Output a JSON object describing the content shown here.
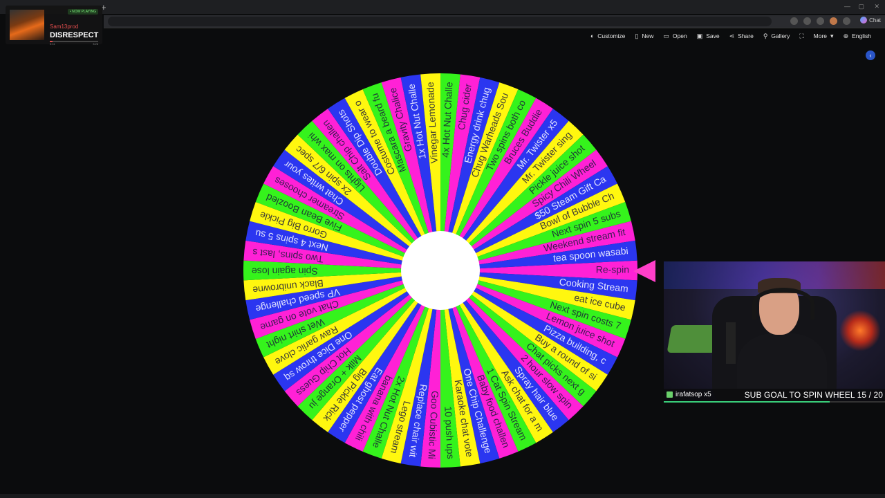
{
  "now_playing": {
    "badge": "• NOW PLAYING",
    "artist": "Sam13prod",
    "title": "DISRESPECT",
    "elapsed": "0:11",
    "duration": "3:26",
    "progress_fraction": 0.05
  },
  "toolbar": {
    "items": [
      {
        "label": "Customize",
        "icon": "palette-icon"
      },
      {
        "label": "New",
        "icon": "file-icon"
      },
      {
        "label": "Open",
        "icon": "folder-icon"
      },
      {
        "label": "Save",
        "icon": "save-icon"
      },
      {
        "label": "Share",
        "icon": "share-icon"
      },
      {
        "label": "Gallery",
        "icon": "search-icon"
      },
      {
        "label": "",
        "icon": "fullscreen-icon"
      },
      {
        "label": "More",
        "icon": "chevron-down-icon"
      },
      {
        "label": "English",
        "icon": "globe-icon"
      }
    ]
  },
  "browser": {
    "chat_label": "Chat"
  },
  "wheel": {
    "segment_colors": [
      "#ff21d6",
      "#2b36f0",
      "#fff70f",
      "#35f31c"
    ],
    "pointer_color": "#ff3fc9",
    "segments": [
      "Re-spin",
      "Cooking Stream",
      "eat ice cube",
      "Next spin costs 7",
      "Lemon juice shot",
      "Pizza building, c",
      "Buy a round of si",
      "Chat picks next g",
      "2 hour slow spin",
      "Spray hair blue",
      "Ask chat for a m",
      "1 Cat Spin Stream",
      "Baby food challen",
      "One Chip Challenge",
      "Karaoke chat vote",
      "10 push ups",
      "Goo Cubistic Mi",
      "Replace chair wit",
      "Lego stream",
      "2x Hot Nut Challe",
      "banana with chili",
      "Eat ghost pepper",
      "Big Pickle Rick",
      "Milk + Orange ju",
      "Hot Chip Guess",
      "One Dice throw sq",
      "Raw garlic clove",
      "Wet shirt night",
      "Chat vote on game",
      "VP speed challenge",
      "Black unibrowne",
      "Spin again lose",
      "Two spins, last s",
      "Next 4 spins 5 su",
      "Gorro Big Pickle",
      "Five Bean Boozled",
      "Streamer chooses",
      "Chat writes your",
      "2x spin 6/7 spec",
      "Lights on max whi",
      "Salt Chip challen",
      "Double Dip Shots",
      "Costume to wear o",
      "Mascara a beard fu",
      "Gravity Chalice",
      "1x Hot Nut Challe",
      "Vinegar Lemonade",
      "4x Hot Nut Challe",
      "Chug cider",
      "Energy drink chug",
      "Chug Warheads Sou",
      "Two spins both co",
      "Bruces Buddie",
      "Mr. Twister x5",
      "Mr. Twister sing",
      "Pickle juice shot",
      "Spicy Chili Wheel",
      "$50 Steam Gift Ca",
      "Bowl of Bubble Ch",
      "Next spin 5 subs",
      "Weekend stream fit",
      "tea spoon wasabi"
    ]
  },
  "webcam": {
    "gifter": "irafatsop x5",
    "goal_text": "SUB GOAL TO SPIN WHEEL 15 / 20",
    "goal_progress": 0.75
  }
}
